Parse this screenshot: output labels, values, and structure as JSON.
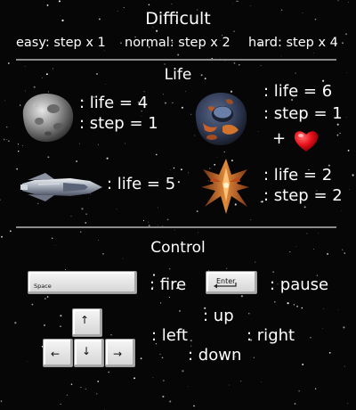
{
  "difficulty": {
    "title": "Difficult",
    "easy": "easy: step x 1",
    "normal": "normal: step x 2",
    "hard": "hard: step x 4"
  },
  "life": {
    "title": "Life",
    "asteroid_grey": {
      "life": ": life = 4",
      "step": ": step = 1"
    },
    "asteroid_lava": {
      "life": ": life = 6",
      "step": ": step = 1",
      "bonus": "+"
    },
    "player_ship": {
      "life": ": life = 5"
    },
    "enemy_ship": {
      "life": ": life = 2",
      "step": ": step = 2"
    }
  },
  "control": {
    "title": "Control",
    "space_key": "Space",
    "enter_key": "Enter",
    "fire": ": fire",
    "pause": ": pause",
    "up": ": up",
    "left": ": left",
    "right": ": right",
    "down": ": down",
    "arrow_up": "↑",
    "arrow_left": "←",
    "arrow_down": "↓",
    "arrow_right": "→"
  },
  "colors": {
    "background": "#060606",
    "text": "#ffffff",
    "separator": "#8a8a8a",
    "heart": "#e8101a"
  },
  "icons": [
    "grey-asteroid-icon",
    "lava-asteroid-icon",
    "heart-icon",
    "player-spaceship-icon",
    "enemy-spaceship-icon"
  ]
}
